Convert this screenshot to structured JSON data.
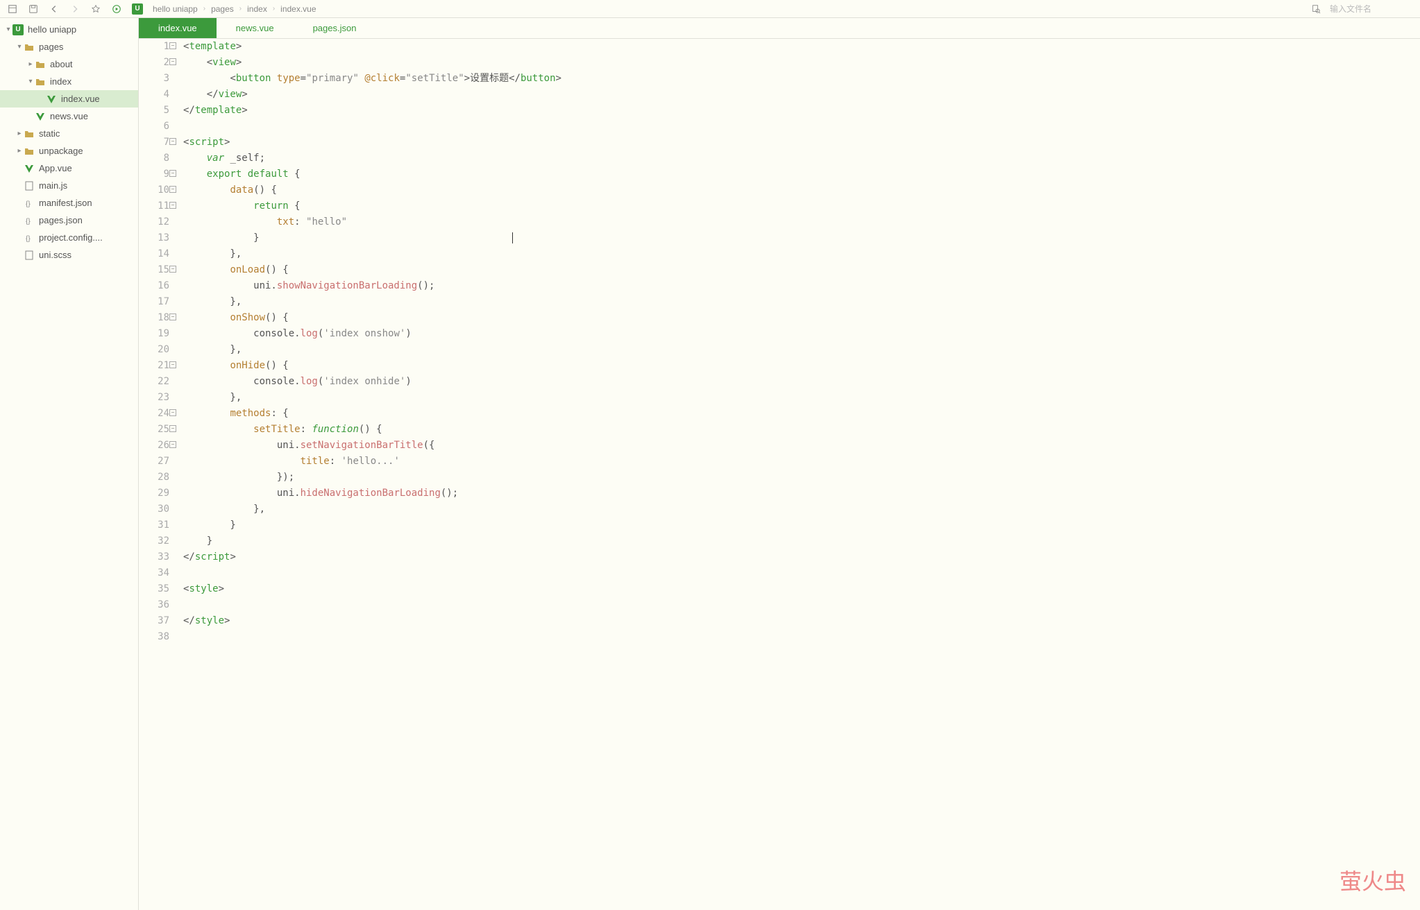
{
  "toolbar": {
    "search_placeholder": "输入文件名"
  },
  "breadcrumb": {
    "project": "hello uniapp",
    "segments": [
      "pages",
      "index",
      "index.vue"
    ]
  },
  "tree": {
    "root": "hello uniapp",
    "root_icon": "U",
    "nodes": [
      {
        "label": "pages",
        "depth": 1,
        "type": "folder",
        "open": true,
        "chevron": true
      },
      {
        "label": "about",
        "depth": 2,
        "type": "folder",
        "chevron": true,
        "open": false
      },
      {
        "label": "index",
        "depth": 2,
        "type": "folder",
        "open": true,
        "chevron": true
      },
      {
        "label": "index.vue",
        "depth": 3,
        "type": "vue",
        "active": true
      },
      {
        "label": "news.vue",
        "depth": 2,
        "type": "vue"
      },
      {
        "label": "static",
        "depth": 1,
        "type": "folder",
        "chevron": true,
        "open": false
      },
      {
        "label": "unpackage",
        "depth": 1,
        "type": "folder",
        "chevron": true,
        "open": false
      },
      {
        "label": "App.vue",
        "depth": 1,
        "type": "vue"
      },
      {
        "label": "main.js",
        "depth": 1,
        "type": "js"
      },
      {
        "label": "manifest.json",
        "depth": 1,
        "type": "json"
      },
      {
        "label": "pages.json",
        "depth": 1,
        "type": "json"
      },
      {
        "label": "project.config....",
        "depth": 1,
        "type": "json"
      },
      {
        "label": "uni.scss",
        "depth": 1,
        "type": "scss"
      }
    ]
  },
  "tabs": [
    {
      "label": "index.vue",
      "active": true
    },
    {
      "label": "news.vue",
      "active": false
    },
    {
      "label": "pages.json",
      "active": false
    }
  ],
  "code": {
    "lines": [
      {
        "n": 1,
        "fold": true,
        "tokens": [
          [
            "c-punc",
            "<"
          ],
          [
            "c-tag",
            "template"
          ],
          [
            "c-punc",
            ">"
          ]
        ]
      },
      {
        "n": 2,
        "fold": true,
        "tokens": [
          [
            "c-plain",
            "    "
          ],
          [
            "c-punc",
            "<"
          ],
          [
            "c-tag",
            "view"
          ],
          [
            "c-punc",
            ">"
          ]
        ]
      },
      {
        "n": 3,
        "tokens": [
          [
            "c-plain",
            "        "
          ],
          [
            "c-punc",
            "<"
          ],
          [
            "c-tag",
            "button"
          ],
          [
            "c-plain",
            " "
          ],
          [
            "c-attr",
            "type"
          ],
          [
            "c-punc",
            "="
          ],
          [
            "c-val",
            "\"primary\""
          ],
          [
            "c-plain",
            " "
          ],
          [
            "c-attr",
            "@click"
          ],
          [
            "c-punc",
            "="
          ],
          [
            "c-val",
            "\"setTitle\""
          ],
          [
            "c-punc",
            ">"
          ],
          [
            "c-plain",
            "设置标题"
          ],
          [
            "c-punc",
            "</"
          ],
          [
            "c-tag",
            "button"
          ],
          [
            "c-punc",
            ">"
          ]
        ]
      },
      {
        "n": 4,
        "tokens": [
          [
            "c-plain",
            "    "
          ],
          [
            "c-punc",
            "</"
          ],
          [
            "c-tag",
            "view"
          ],
          [
            "c-punc",
            ">"
          ]
        ]
      },
      {
        "n": 5,
        "tokens": [
          [
            "c-punc",
            "</"
          ],
          [
            "c-tag",
            "template"
          ],
          [
            "c-punc",
            ">"
          ]
        ]
      },
      {
        "n": 6,
        "tokens": []
      },
      {
        "n": 7,
        "fold": true,
        "tokens": [
          [
            "c-punc",
            "<"
          ],
          [
            "c-tag",
            "script"
          ],
          [
            "c-punc",
            ">"
          ]
        ]
      },
      {
        "n": 8,
        "tokens": [
          [
            "c-plain",
            "    "
          ],
          [
            "c-kw",
            "var"
          ],
          [
            "c-plain",
            " _self;"
          ]
        ]
      },
      {
        "n": 9,
        "fold": true,
        "tokens": [
          [
            "c-plain",
            "    "
          ],
          [
            "c-kw2",
            "export"
          ],
          [
            "c-plain",
            " "
          ],
          [
            "c-kw2",
            "default"
          ],
          [
            "c-plain",
            " {"
          ]
        ]
      },
      {
        "n": 10,
        "fold": true,
        "tokens": [
          [
            "c-plain",
            "        "
          ],
          [
            "c-prop",
            "data"
          ],
          [
            "c-plain",
            "() {"
          ]
        ]
      },
      {
        "n": 11,
        "fold": true,
        "tokens": [
          [
            "c-plain",
            "            "
          ],
          [
            "c-kw2",
            "return"
          ],
          [
            "c-plain",
            " {"
          ]
        ]
      },
      {
        "n": 12,
        "tokens": [
          [
            "c-plain",
            "                "
          ],
          [
            "c-prop",
            "txt"
          ],
          [
            "c-plain",
            ": "
          ],
          [
            "c-str",
            "\"hello\""
          ]
        ]
      },
      {
        "n": 13,
        "tokens": [
          [
            "c-plain",
            "            }"
          ]
        ],
        "cursor_after": true
      },
      {
        "n": 14,
        "tokens": [
          [
            "c-plain",
            "        },"
          ]
        ]
      },
      {
        "n": 15,
        "fold": true,
        "tokens": [
          [
            "c-plain",
            "        "
          ],
          [
            "c-prop",
            "onLoad"
          ],
          [
            "c-plain",
            "() {"
          ]
        ]
      },
      {
        "n": 16,
        "tokens": [
          [
            "c-plain",
            "            uni."
          ],
          [
            "c-method",
            "showNavigationBarLoading"
          ],
          [
            "c-plain",
            "();"
          ]
        ]
      },
      {
        "n": 17,
        "tokens": [
          [
            "c-plain",
            "        },"
          ]
        ]
      },
      {
        "n": 18,
        "fold": true,
        "tokens": [
          [
            "c-plain",
            "        "
          ],
          [
            "c-prop",
            "onShow"
          ],
          [
            "c-plain",
            "() {"
          ]
        ]
      },
      {
        "n": 19,
        "tokens": [
          [
            "c-plain",
            "            console."
          ],
          [
            "c-method",
            "log"
          ],
          [
            "c-plain",
            "("
          ],
          [
            "c-str",
            "'index onshow'"
          ],
          [
            "c-plain",
            ")"
          ]
        ]
      },
      {
        "n": 20,
        "tokens": [
          [
            "c-plain",
            "        },"
          ]
        ]
      },
      {
        "n": 21,
        "fold": true,
        "tokens": [
          [
            "c-plain",
            "        "
          ],
          [
            "c-prop",
            "onHide"
          ],
          [
            "c-plain",
            "() {"
          ]
        ]
      },
      {
        "n": 22,
        "tokens": [
          [
            "c-plain",
            "            console."
          ],
          [
            "c-method",
            "log"
          ],
          [
            "c-plain",
            "("
          ],
          [
            "c-str",
            "'index onhide'"
          ],
          [
            "c-plain",
            ")"
          ]
        ]
      },
      {
        "n": 23,
        "tokens": [
          [
            "c-plain",
            "        },"
          ]
        ]
      },
      {
        "n": 24,
        "fold": true,
        "tokens": [
          [
            "c-plain",
            "        "
          ],
          [
            "c-prop",
            "methods"
          ],
          [
            "c-plain",
            ": {"
          ]
        ]
      },
      {
        "n": 25,
        "fold": true,
        "tokens": [
          [
            "c-plain",
            "            "
          ],
          [
            "c-prop",
            "setTitle"
          ],
          [
            "c-plain",
            ": "
          ],
          [
            "c-kw",
            "function"
          ],
          [
            "c-plain",
            "() {"
          ]
        ]
      },
      {
        "n": 26,
        "fold": true,
        "tokens": [
          [
            "c-plain",
            "                uni."
          ],
          [
            "c-method",
            "setNavigationBarTitle"
          ],
          [
            "c-plain",
            "({"
          ]
        ]
      },
      {
        "n": 27,
        "tokens": [
          [
            "c-plain",
            "                    "
          ],
          [
            "c-prop",
            "title"
          ],
          [
            "c-plain",
            ": "
          ],
          [
            "c-str",
            "'hello...'"
          ]
        ]
      },
      {
        "n": 28,
        "tokens": [
          [
            "c-plain",
            "                });"
          ]
        ]
      },
      {
        "n": 29,
        "tokens": [
          [
            "c-plain",
            "                uni."
          ],
          [
            "c-method",
            "hideNavigationBarLoading"
          ],
          [
            "c-plain",
            "();"
          ]
        ]
      },
      {
        "n": 30,
        "tokens": [
          [
            "c-plain",
            "            },"
          ]
        ]
      },
      {
        "n": 31,
        "tokens": [
          [
            "c-plain",
            "        }"
          ]
        ]
      },
      {
        "n": 32,
        "tokens": [
          [
            "c-plain",
            "    }"
          ]
        ]
      },
      {
        "n": 33,
        "tokens": [
          [
            "c-punc",
            "</"
          ],
          [
            "c-tag",
            "script"
          ],
          [
            "c-punc",
            ">"
          ]
        ]
      },
      {
        "n": 34,
        "tokens": []
      },
      {
        "n": 35,
        "tokens": [
          [
            "c-punc",
            "<"
          ],
          [
            "c-tag",
            "style"
          ],
          [
            "c-punc",
            ">"
          ]
        ]
      },
      {
        "n": 36,
        "tokens": []
      },
      {
        "n": 37,
        "tokens": [
          [
            "c-punc",
            "</"
          ],
          [
            "c-tag",
            "style"
          ],
          [
            "c-punc",
            ">"
          ]
        ]
      },
      {
        "n": 38,
        "tokens": []
      }
    ]
  },
  "watermark": "萤火虫"
}
